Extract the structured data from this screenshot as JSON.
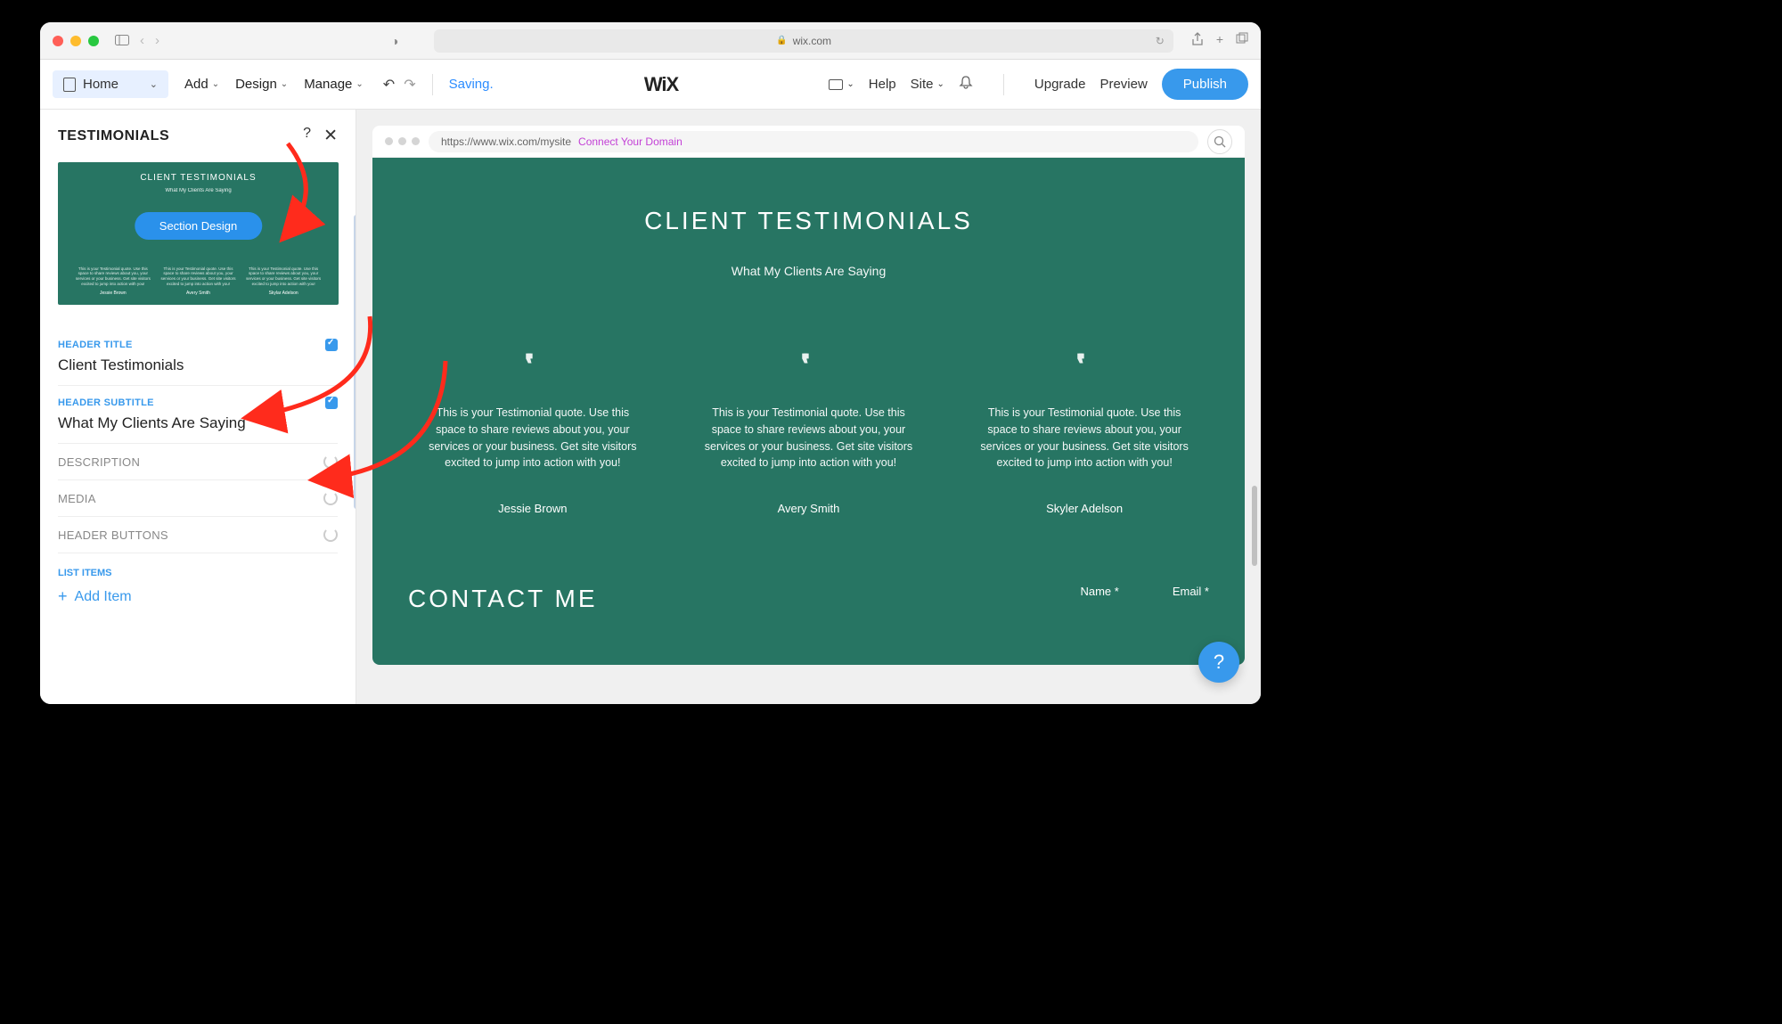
{
  "browser": {
    "url_host": "wix.com"
  },
  "toolbar": {
    "page_name": "Home",
    "add": "Add",
    "design": "Design",
    "manage": "Manage",
    "saving": "Saving.",
    "help": "Help",
    "site": "Site",
    "upgrade": "Upgrade",
    "preview": "Preview",
    "publish": "Publish",
    "logo": "WiX"
  },
  "panel": {
    "title": "TESTIMONIALS",
    "thumb": {
      "title": "CLIENT TESTIMONIALS",
      "subtitle": "What My Clients Are Saying",
      "button": "Section Design",
      "quote": "This is your Testimonial quote. Use this space to share reviews about you, your services or your business. Get site visitors excited to jump into action with you!",
      "names": [
        "Jessie Brown",
        "Avery Smith",
        "Skylar Adelson"
      ]
    },
    "fields": {
      "header_title_label": "HEADER TITLE",
      "header_title_value": "Client Testimonials",
      "header_subtitle_label": "HEADER SUBTITLE",
      "header_subtitle_value": "What My Clients Are Saying",
      "description_label": "DESCRIPTION",
      "media_label": "MEDIA",
      "header_buttons_label": "HEADER BUTTONS",
      "list_items_label": "LIST ITEMS",
      "add_item": "Add Item"
    }
  },
  "canvas": {
    "site_url": "https://www.wix.com/mysite",
    "connect": "Connect Your Domain",
    "title": "CLIENT TESTIMONIALS",
    "subtitle": "What My Clients Are Saying",
    "testimonials": [
      {
        "quote": "This is your Testimonial quote. Use this space to share reviews about you, your services or your business. Get site visitors excited to jump into action with you!",
        "name": "Jessie Brown"
      },
      {
        "quote": "This is your Testimonial quote. Use this space to share reviews about you, your services or your business. Get site visitors excited to jump into action with you!",
        "name": "Avery Smith"
      },
      {
        "quote": "This is your Testimonial quote. Use this space to share reviews about you, your services or your business. Get site visitors excited to jump into action with you!",
        "name": "Skyler Adelson"
      }
    ],
    "contact_title": "CONTACT ME",
    "name_field": "Name *",
    "email_field": "Email *"
  }
}
